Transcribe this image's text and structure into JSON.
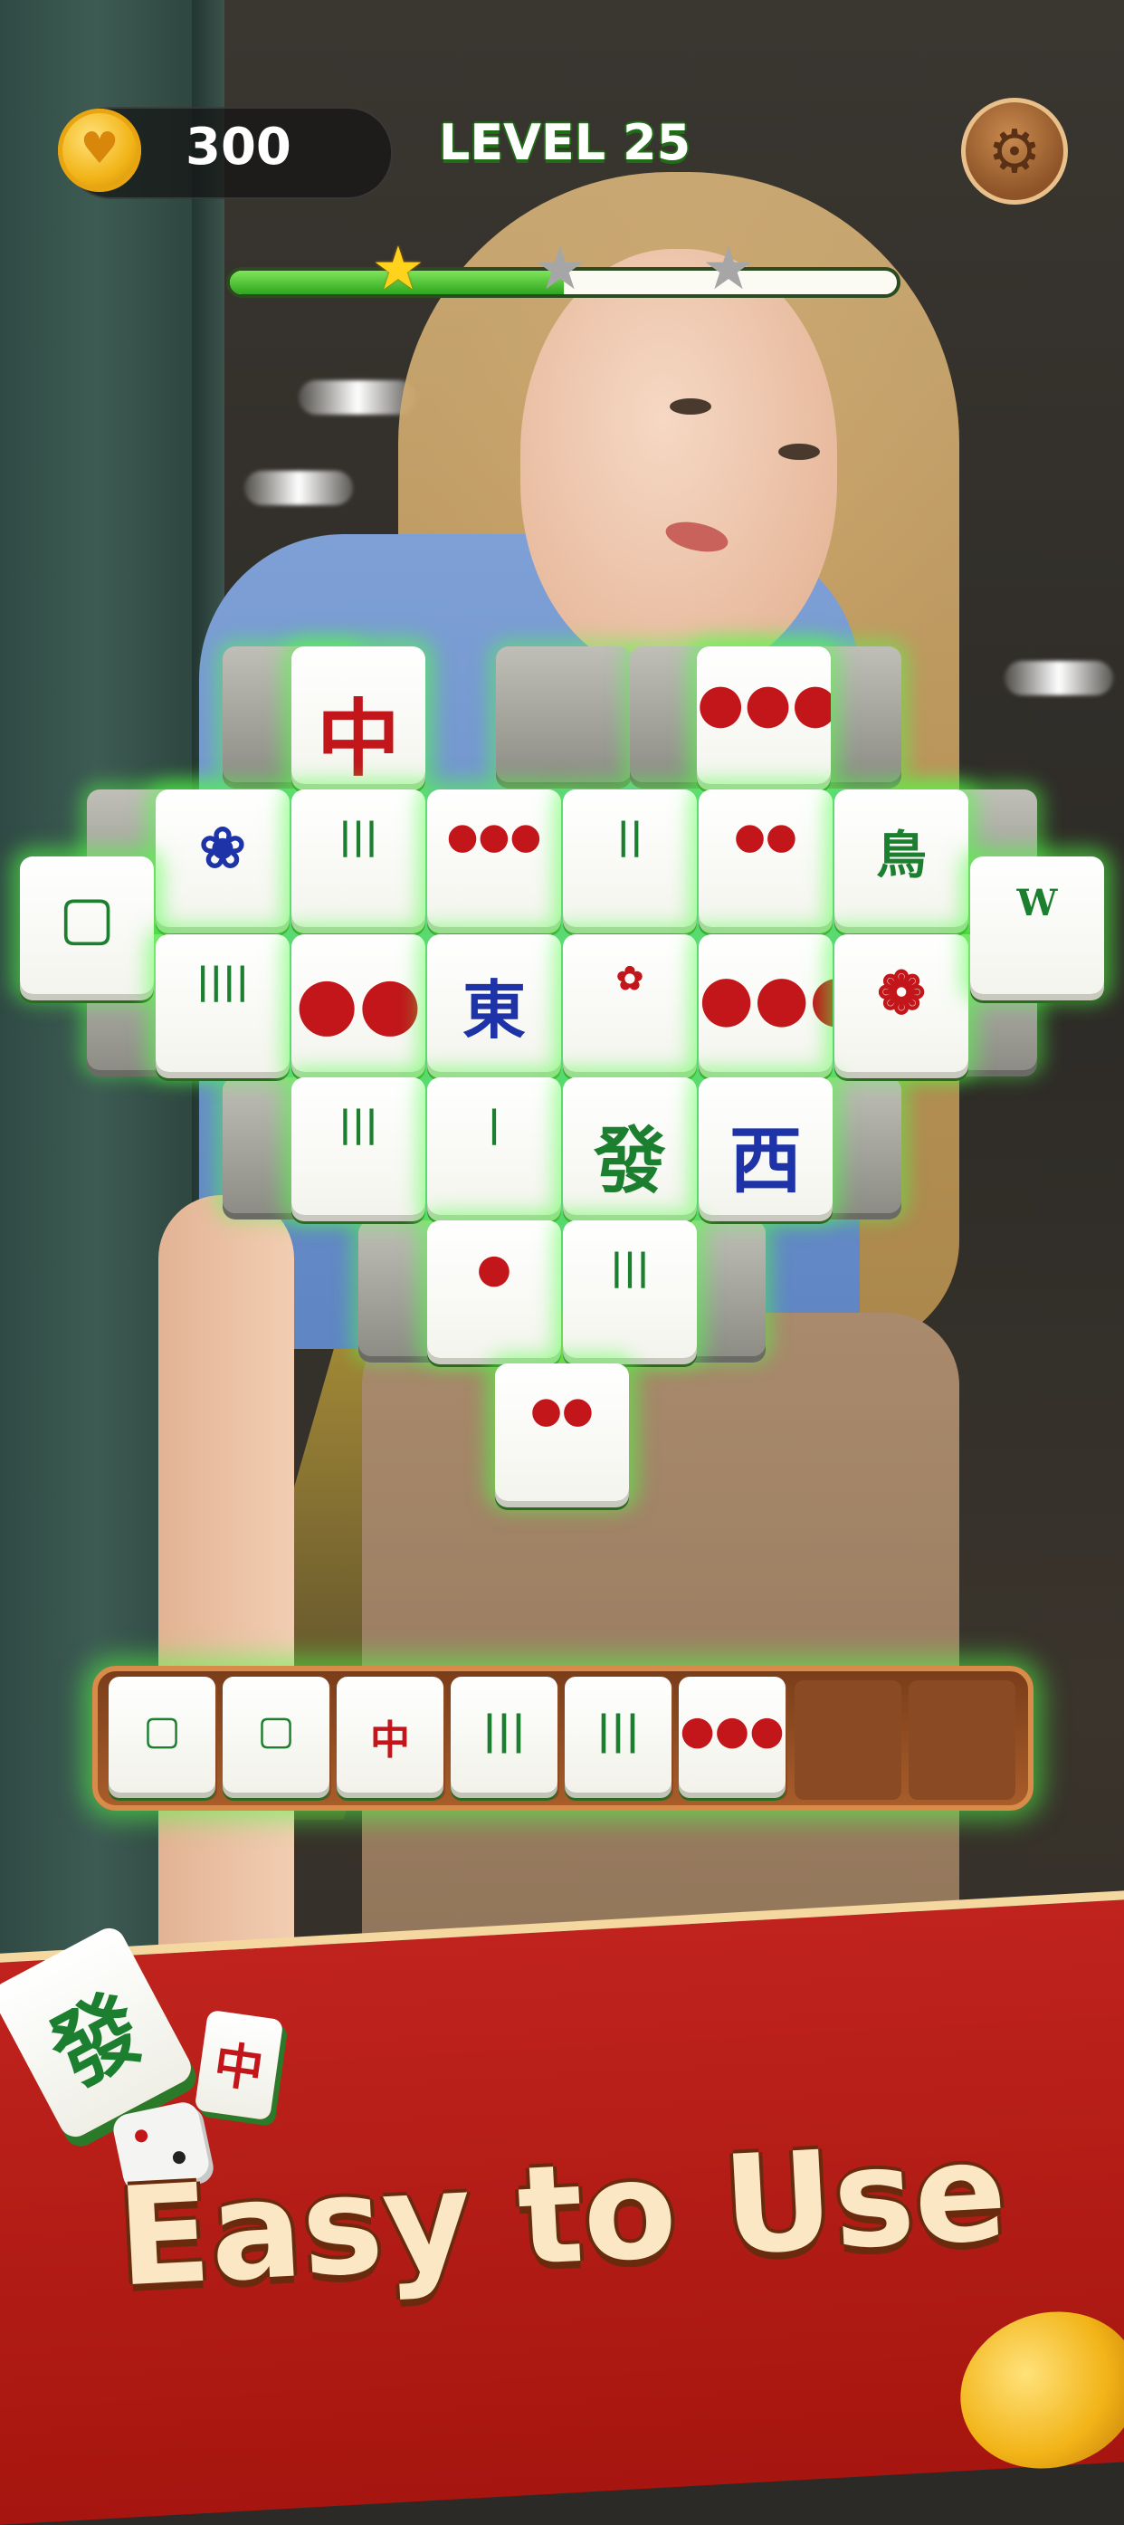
{
  "hud": {
    "coins": "300",
    "level_label": "LEVEL 25",
    "settings_icon": "gear-icon",
    "coin_icon": "heart-coin-icon",
    "progress_fraction": 0.5,
    "stars_earned": 1,
    "stars_total": 3
  },
  "board": {
    "tiles": [
      {
        "face": "red-dragon",
        "glyph": "中"
      },
      {
        "face": "dots-3",
        "glyph": "●●●"
      },
      {
        "face": "iris-flower",
        "glyph": "❀"
      },
      {
        "face": "bamboo-7",
        "glyph": "|||"
      },
      {
        "face": "dots-7",
        "glyph": "●●●"
      },
      {
        "face": "bamboo-4",
        "glyph": "||"
      },
      {
        "face": "dots-4",
        "glyph": "●●"
      },
      {
        "face": "bamboo-1-bird",
        "glyph": "鳥"
      },
      {
        "face": "white-dragon",
        "glyph": "▢"
      },
      {
        "face": "bamboo-8",
        "glyph": "||||"
      },
      {
        "face": "dots-5",
        "glyph": "●●"
      },
      {
        "face": "east-wind",
        "glyph": "東"
      },
      {
        "face": "chrysanthemum-flower",
        "glyph": "✿"
      },
      {
        "face": "dots-9",
        "glyph": "●●●"
      },
      {
        "face": "plum-flower",
        "glyph": "❁"
      },
      {
        "face": "bamboo-8-w",
        "glyph": "W"
      },
      {
        "face": "bamboo-6",
        "glyph": "|||"
      },
      {
        "face": "bamboo-2",
        "glyph": "|"
      },
      {
        "face": "green-dragon",
        "glyph": "發"
      },
      {
        "face": "west-wind",
        "glyph": "西"
      },
      {
        "face": "dots-2",
        "glyph": "●"
      },
      {
        "face": "bamboo-9",
        "glyph": "|||"
      },
      {
        "face": "dots-6",
        "glyph": "●●"
      }
    ]
  },
  "tray": {
    "slots_total": 8,
    "tiles": [
      {
        "face": "white-dragon",
        "glyph": "▢"
      },
      {
        "face": "white-dragon",
        "glyph": "▢"
      },
      {
        "face": "red-dragon",
        "glyph": "中"
      },
      {
        "face": "bamboo-6",
        "glyph": "|||"
      },
      {
        "face": "bamboo-6",
        "glyph": "|||"
      },
      {
        "face": "dots-3",
        "glyph": "●●●"
      }
    ]
  },
  "banner": {
    "headline": "Easy to Use",
    "deco_tile_large": "發",
    "deco_tile_small": "中"
  },
  "colors": {
    "accent_green": "#2ea51f",
    "banner_red": "#b81d17",
    "banner_text": "#fbe7c3",
    "star_gold": "#ffd21c"
  }
}
